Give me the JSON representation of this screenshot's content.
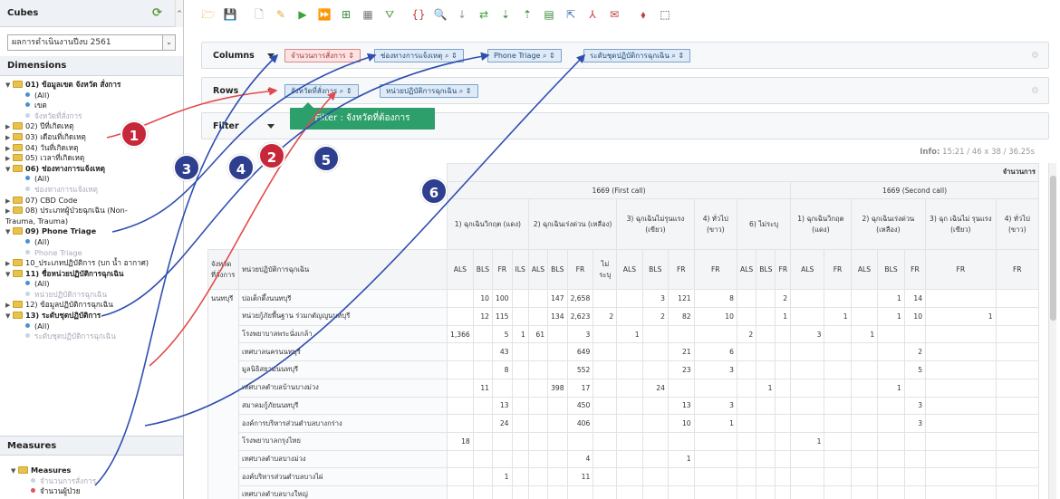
{
  "left": {
    "cubes_title": "Cubes",
    "cube_selected": "ผลการดำเนินงานปีงบ 2561",
    "dimensions_title": "Dimensions",
    "tree": [
      {
        "type": "folder",
        "label": "01) ข้อมูลเขต จังหวัด สั่งการ",
        "open": true
      },
      {
        "type": "leaf",
        "label": "(All)",
        "state": "normal"
      },
      {
        "type": "leaf",
        "label": "เขต",
        "state": "normal"
      },
      {
        "type": "leaf",
        "label": "จังหวัดที่สั่งการ",
        "state": "dim"
      },
      {
        "type": "folder",
        "label": "02) ปีที่เกิดเหตุ",
        "open": false
      },
      {
        "type": "folder",
        "label": "03) เดือนที่เกิดเหตุ",
        "open": false
      },
      {
        "type": "folder",
        "label": "04) วันที่เกิดเหตุ",
        "open": false
      },
      {
        "type": "folder",
        "label": "05) เวลาที่เกิดเหตุ",
        "open": false
      },
      {
        "type": "folder",
        "label": "06) ช่องทางการแจ้งเหตุ",
        "open": true
      },
      {
        "type": "leaf",
        "label": "(All)",
        "state": "normal"
      },
      {
        "type": "leaf",
        "label": "ช่องทางการแจ้งเหตุ",
        "state": "dim"
      },
      {
        "type": "folder",
        "label": "07) CBD Code",
        "open": false
      },
      {
        "type": "folder",
        "label": "08) ประเภทผู้ป่วยฉุกเฉิน (Non-",
        "open": false
      },
      {
        "type": "text",
        "label": "Trauma, Trauma)"
      },
      {
        "type": "folder",
        "label": "09) Phone Triage",
        "open": true
      },
      {
        "type": "leaf",
        "label": "(All)",
        "state": "normal"
      },
      {
        "type": "leaf",
        "label": "Phone Triage",
        "state": "dim"
      },
      {
        "type": "folder",
        "label": "10_ประเภทปฏิบัติการ (บก น้ำ อากาศ)",
        "open": false
      },
      {
        "type": "folder",
        "label": "11) ชื่อหน่วยปฏิบัติการฉุกเฉิน",
        "open": true
      },
      {
        "type": "leaf",
        "label": "(All)",
        "state": "normal"
      },
      {
        "type": "leaf",
        "label": "หน่วยปฏิบัติการฉุกเฉิน",
        "state": "dim"
      },
      {
        "type": "folder",
        "label": "12) ข้อมูลปฏิบัติการฉุกเฉิน",
        "open": false
      },
      {
        "type": "folder",
        "label": "13) ระดับชุดปฏิบัติการ",
        "open": true
      },
      {
        "type": "leaf",
        "label": "(All)",
        "state": "normal"
      },
      {
        "type": "leaf",
        "label": "ระดับชุดปฏิบัติการฉุกเฉิน",
        "state": "dim"
      }
    ],
    "measures_title": "Measures",
    "measures": [
      {
        "type": "folder",
        "label": "Measures",
        "open": true
      },
      {
        "type": "leaf",
        "label": "จำนวนการสั่งการ",
        "state": "dim"
      },
      {
        "type": "leaf",
        "label": "จำนวนผู้ป่วย",
        "state": "red"
      }
    ]
  },
  "toolbar": {
    "icons": [
      "folder-open-icon",
      "save-icon",
      "new-icon",
      "edit-icon",
      "play-icon",
      "fast-play-icon",
      "layout-icon",
      "table-icon",
      "filter-icon",
      "mdx-icon",
      "zoom-icon",
      "drill-icon",
      "swap-axis-icon",
      "sort-asc-icon",
      "sort-desc-icon",
      "chart-icon",
      "export-icon",
      "pdf-icon",
      "report-icon",
      "tag-icon",
      "fullscreen-icon"
    ],
    "glyphs": [
      "🗁",
      "💾",
      "🗋",
      "✎",
      "▶",
      "⏩",
      "⊞",
      "▦",
      "⛛",
      "{}",
      "🔍",
      "↓",
      "⇄",
      "⇣",
      "⇡",
      "▤",
      "⇱",
      "⅄",
      "✉",
      "⬧",
      "⬚"
    ],
    "colors": [
      "#e8a93a",
      "#3a6fb0",
      "#999",
      "#e8a93a",
      "#3aa33a",
      "#3aa33a",
      "#3a8a3a",
      "#777",
      "#5a9a3e",
      "#c04040",
      "#3a6fb0",
      "#999",
      "#3aa33a",
      "#3a8a3a",
      "#3a8a3a",
      "#3a8a3a",
      "#3a6fb0",
      "#c04040",
      "#c04040",
      "#c04040",
      "#333"
    ]
  },
  "columns_label": "Columns",
  "rows_label": "Rows",
  "filter_label": "Filter",
  "columns_pills": [
    "จำนวนการสั่งการ ⇕",
    "ช่องทางการแจ้งเหตุ ⌕ ⇕",
    "Phone Triage ⌕ ⇕",
    "ระดับชุดปฏิบัติการฉุกเฉิน ⌕ ⇕"
  ],
  "rows_pills": [
    "จังหวัดที่สั่งการ ⌕ ⇕",
    "หน่วยปฏิบัติการฉุกเฉิน ⌕ ⇕"
  ],
  "tooltip": "Filter : จังหวัดที่ต้องการ",
  "info": {
    "label": "Info:",
    "time": "15:21",
    "size": "46 x 38",
    "secs": "36.25s"
  },
  "annotations": [
    "1",
    "2",
    "3",
    "4",
    "5",
    "6"
  ],
  "table": {
    "measure_header": "จำนวนการ",
    "call_groups": [
      "1669 (First call)",
      "1669 (Second call)"
    ],
    "triage_first": [
      "1) ฉุกเฉินวิกฤต (แดง)",
      "2) ฉุกเฉินเร่งด่วน (เหลือง)",
      "3) ฉุกเฉินไม่รุนแรง (เขียว)",
      "4) ทั่วไป (ขาว)",
      "6) ไม่ระบุ"
    ],
    "triage_second": [
      "1) ฉุกเฉินวิกฤต (แดง)",
      "2) ฉุกเฉินเร่งด่วน (เหลือง)",
      "3) ฉุก เฉินไม่ รุนแรง (เขียว)",
      "4) ทั่วไป (ขาว)"
    ],
    "row_header_1": "จังหวัดที่สั่งการ",
    "row_header_2": "หน่วยปฏิบัติการฉุกเฉิน",
    "levels": [
      "ALS",
      "BLS",
      "FR",
      "ILS",
      "ALS",
      "BLS",
      "FR",
      "ไม่ระบุ",
      "ALS",
      "BLS",
      "FR",
      "FR",
      "ALS",
      "BLS",
      "FR",
      "ALS",
      "FR",
      "ALS",
      "BLS",
      "FR",
      "FR",
      "FR"
    ],
    "province": "นนทบุรี",
    "rows": [
      {
        "name": "ปอเต็กตึ้งนนทบุรี",
        "v": [
          "",
          "10",
          "100",
          "",
          "",
          "147",
          "2,658",
          "",
          "",
          "3",
          "121",
          "8",
          "",
          "",
          "2",
          "",
          "",
          "",
          "1",
          "14",
          "",
          ""
        ]
      },
      {
        "name": "หน่วยกู้ภัยพื้นฐาน ร่วมกตัญญูนนทบุรี",
        "v": [
          "",
          "12",
          "115",
          "",
          "",
          "134",
          "2,623",
          "2",
          "",
          "2",
          "82",
          "10",
          "",
          "",
          "1",
          "",
          "1",
          "",
          "1",
          "10",
          "1",
          ""
        ]
      },
      {
        "name": "โรงพยาบาลพระนั่งเกล้า",
        "v": [
          "1,366",
          "",
          "5",
          "1",
          "61",
          "",
          "3",
          "",
          "1",
          "",
          "",
          "",
          "2",
          "",
          "",
          "3",
          "",
          "1",
          "",
          "",
          "",
          ""
        ]
      },
      {
        "name": "เทศบาลนครนนทบุรี",
        "v": [
          "",
          "",
          "43",
          "",
          "",
          "",
          "649",
          "",
          "",
          "",
          "21",
          "6",
          "",
          "",
          "",
          "",
          "",
          "",
          "",
          "2",
          "",
          ""
        ]
      },
      {
        "name": "มูลนิธิสยามนนทบุรี",
        "v": [
          "",
          "",
          "8",
          "",
          "",
          "",
          "552",
          "",
          "",
          "",
          "23",
          "3",
          "",
          "",
          "",
          "",
          "",
          "",
          "",
          "5",
          "",
          ""
        ]
      },
      {
        "name": "เทศบาลตำบลบ้านบางม่วง",
        "v": [
          "",
          "11",
          "",
          "",
          "",
          "398",
          "17",
          "",
          "",
          "24",
          "",
          "",
          "",
          "1",
          "",
          "",
          "",
          "",
          "1",
          "",
          "",
          ""
        ]
      },
      {
        "name": "สมาคมกู้ภัยนนทบุรี",
        "v": [
          "",
          "",
          "13",
          "",
          "",
          "",
          "450",
          "",
          "",
          "",
          "13",
          "3",
          "",
          "",
          "",
          "",
          "",
          "",
          "",
          "3",
          "",
          ""
        ]
      },
      {
        "name": "องค์การบริหารส่วนตำบลบางกร่าง",
        "v": [
          "",
          "",
          "24",
          "",
          "",
          "",
          "406",
          "",
          "",
          "",
          "10",
          "1",
          "",
          "",
          "",
          "",
          "",
          "",
          "",
          "3",
          "",
          ""
        ]
      },
      {
        "name": "โรงพยาบาลกรุงไทย",
        "v": [
          "18",
          "",
          "",
          "",
          "",
          "",
          "",
          "",
          "",
          "",
          "",
          "",
          "",
          "",
          "",
          "1",
          "",
          "",
          "",
          "",
          "",
          ""
        ]
      },
      {
        "name": "เทศบาลตำบลบางม่วง",
        "v": [
          "",
          "",
          "",
          "",
          "",
          "",
          "4",
          "",
          "",
          "",
          "1",
          "",
          "",
          "",
          "",
          "",
          "",
          "",
          "",
          "",
          "",
          ""
        ]
      },
      {
        "name": "องค์บริหารส่วนตำบลบางไผ่",
        "v": [
          "",
          "",
          "1",
          "",
          "",
          "",
          "11",
          "",
          "",
          "",
          "",
          "",
          "",
          "",
          "",
          "",
          "",
          "",
          "",
          "",
          "",
          ""
        ]
      },
      {
        "name": "เทศบาลตำบลบางใหญ่",
        "v": [
          "",
          "",
          "",
          "",
          "",
          "",
          "",
          "",
          "",
          "",
          "",
          "",
          "",
          "",
          "",
          "",
          "",
          "",
          "",
          "",
          "",
          ""
        ]
      }
    ]
  }
}
